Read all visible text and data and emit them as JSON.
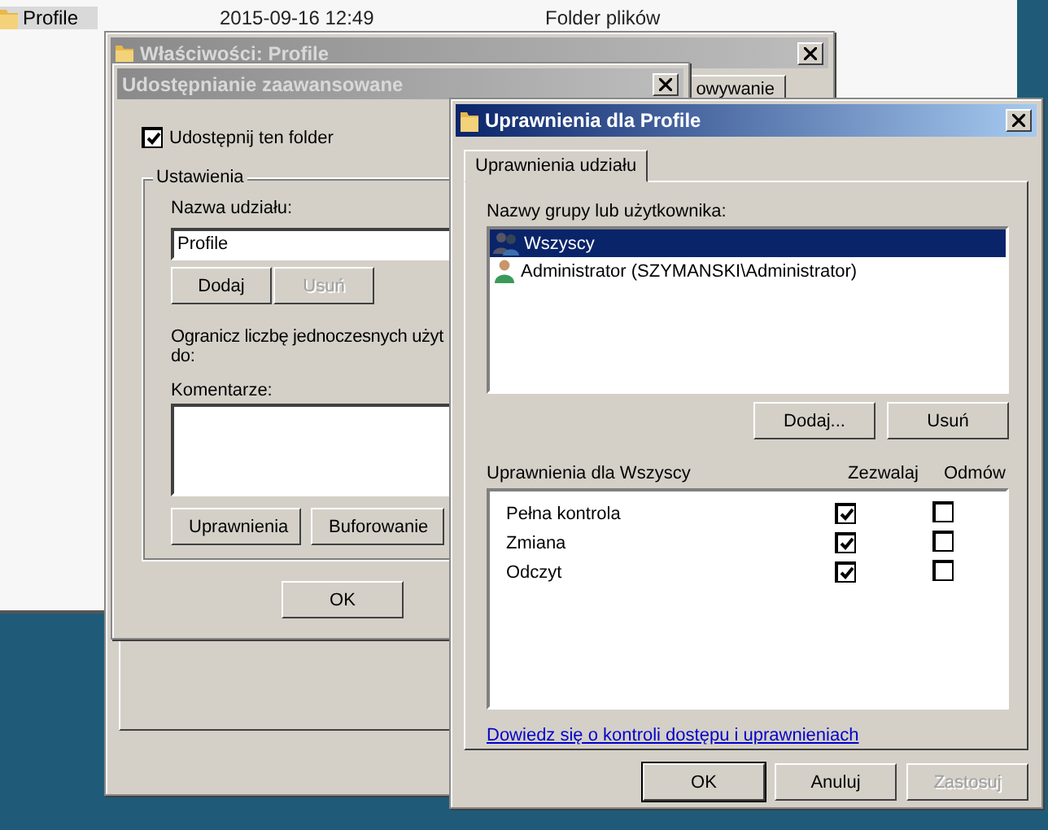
{
  "explorer": {
    "rows": [
      {
        "name": "Profile",
        "date": "2015-09-16 12:49",
        "type": "Folder plików",
        "selected": true
      }
    ]
  },
  "properties_window": {
    "title": "Właściwości: Profile",
    "tab": "owywanie",
    "active": false
  },
  "advanced_sharing": {
    "title": "Udostępnianie zaawansowane",
    "active": false,
    "share_checkbox": {
      "label": "Udostępnij ten folder",
      "checked": true
    },
    "group_title": "Ustawienia",
    "share_name_label": "Nazwa udziału:",
    "share_name": "Profile",
    "name_buttons": [
      {
        "label": "Dodaj",
        "disabled": false
      },
      {
        "label": "Usuń",
        "disabled": true
      }
    ],
    "limit_text": [
      "Ogranicz liczbę jednoczesnych użyt",
      "do:"
    ],
    "comments_label": "Komentarze:",
    "group_buttons": [
      {
        "label": "Uprawnienia",
        "disabled": false
      },
      {
        "label": "Buforowanie",
        "disabled": false
      }
    ],
    "buttons": [
      {
        "label": "OK",
        "disabled": false
      }
    ]
  },
  "permissions_window": {
    "title": "Uprawnienia dla Profile",
    "active": true,
    "tabs": [
      {
        "label": "Uprawnienia udziału",
        "selected": true
      }
    ],
    "users_label": "Nazwy grupy lub użytkownika:",
    "users": [
      {
        "name": "Wszyscy",
        "kind": "group",
        "selected": true
      },
      {
        "name": "Administrator (SZYMANSKI\\Administrator)",
        "kind": "user",
        "selected": false
      }
    ],
    "user_buttons": [
      {
        "label": "Dodaj...",
        "disabled": false
      },
      {
        "label": "Usuń",
        "disabled": false
      }
    ],
    "permissions_header": "Uprawnienia dla Wszyscy",
    "allow_header": "Zezwalaj",
    "deny_header": "Odmów",
    "permissions": [
      {
        "name": "Pełna kontrola",
        "allow": true,
        "deny": false
      },
      {
        "name": "Zmiana",
        "allow": true,
        "deny": false
      },
      {
        "name": "Odczyt",
        "allow": true,
        "deny": false
      }
    ],
    "link": "Dowiedz się o kontroli dostępu i uprawnieniach",
    "buttons": [
      {
        "label": "OK",
        "disabled": false,
        "default": true
      },
      {
        "label": "Anuluj",
        "disabled": false,
        "default": false
      },
      {
        "label": "Zastosuj",
        "disabled": true,
        "default": false
      }
    ]
  }
}
